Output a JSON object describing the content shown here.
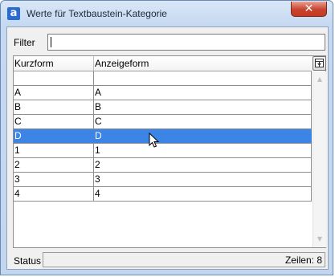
{
  "window": {
    "title": "Werte für Textbaustein-Kategorie",
    "app_icon_letter": "a",
    "close_symbol": "✕"
  },
  "filter": {
    "label": "Filter",
    "value": ""
  },
  "grid": {
    "columns": [
      "Kurzform",
      "Anzeigeform"
    ],
    "column_chooser_icon": "column-chooser-icon",
    "rows": [
      {
        "kurzform": "",
        "anzeigeform": ""
      },
      {
        "kurzform": "A",
        "anzeigeform": "A"
      },
      {
        "kurzform": "B",
        "anzeigeform": "B"
      },
      {
        "kurzform": "C",
        "anzeigeform": "C"
      },
      {
        "kurzform": "D",
        "anzeigeform": "D"
      },
      {
        "kurzform": "1",
        "anzeigeform": "1"
      },
      {
        "kurzform": "2",
        "anzeigeform": "2"
      },
      {
        "kurzform": "3",
        "anzeigeform": "3"
      },
      {
        "kurzform": "4",
        "anzeigeform": "4"
      }
    ],
    "selected_row": 4
  },
  "status": {
    "label": "Status",
    "count_text": "Zeilen: 8"
  },
  "colors": {
    "selection": "#3c85e6",
    "close_button": "#c8442e"
  }
}
